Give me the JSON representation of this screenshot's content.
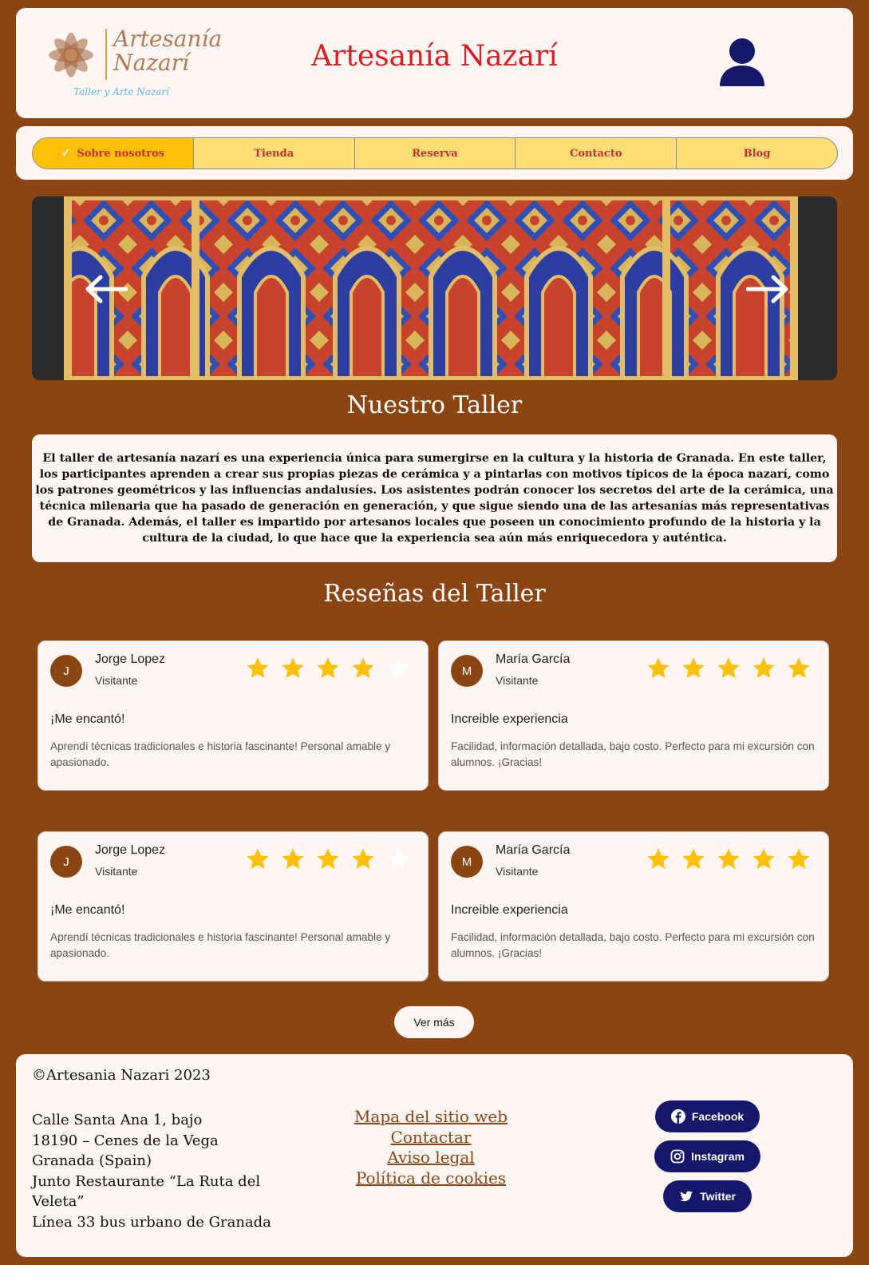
{
  "header": {
    "logo_line1": "Artesanía",
    "logo_line2": "Nazarí",
    "logo_tagline": "Taller y Arte Nazarí",
    "title": "Artesanía Nazarí"
  },
  "nav": {
    "items": [
      {
        "label": "Sobre nosotros",
        "active": true
      },
      {
        "label": "Tienda",
        "active": false
      },
      {
        "label": "Reserva",
        "active": false
      },
      {
        "label": "Contacto",
        "active": false
      },
      {
        "label": "Blog",
        "active": false
      }
    ]
  },
  "about": {
    "title": "Nuestro Taller",
    "text": "El taller de artesanía nazarí es una experiencia única para sumergirse en la cultura y la historia de Granada. En este taller, los participantes aprenden a crear sus propias piezas de cerámica y a pintarlas con motivos típicos de la época nazarí, como los patrones geométricos y las influencias andalusíes. Los asistentes podrán conocer los secretos del arte de la cerámica, una técnica milenaria que ha pasado de generación en generación, y que sigue siendo una de las artesanías más representativas de Granada. Además, el taller es impartido por artesanos locales que poseen un conocimiento profundo de la historia y la cultura de la ciudad, lo que hace que la experiencia sea aún más enriquecedora y auténtica."
  },
  "reviews": {
    "title": "Reseñas del Taller",
    "items": [
      {
        "initial": "J",
        "name": "Jorge Lopez",
        "role": "Visitante",
        "rating": 4,
        "title": "¡Me encantó!",
        "body": "Aprendí técnicas tradicionales e historia fascinante! Personal amable y apasionado."
      },
      {
        "initial": "M",
        "name": "María García",
        "role": "Visitante",
        "rating": 5,
        "title": "Increible experiencia",
        "body": "Facilidad, información detallada, bajo costo. Perfecto para mi excursión con alumnos. ¡Gracias!"
      },
      {
        "initial": "J",
        "name": "Jorge Lopez",
        "role": "Visitante",
        "rating": 4,
        "title": "¡Me encantó!",
        "body": "Aprendí técnicas tradicionales e historia fascinante! Personal amable y apasionado."
      },
      {
        "initial": "M",
        "name": "María García",
        "role": "Visitante",
        "rating": 5,
        "title": "Increible experiencia",
        "body": "Facilidad, información detallada, bajo costo. Perfecto para mi excursión con alumnos. ¡Gracias!"
      }
    ],
    "more_label": "Ver más"
  },
  "footer": {
    "copyright": "©Artesania Nazari 2023",
    "address": [
      "Calle Santa Ana 1, bajo",
      "18190 – Cenes de la Vega",
      "Granada (Spain)",
      "Junto Restaurante “La Ruta del Veleta”",
      "Línea 33 bus urbano de Granada"
    ],
    "links": [
      "Mapa del sitio web",
      "Contactar",
      "Aviso legal",
      "Política de cookies"
    ],
    "social": [
      "Facebook",
      "Instagram",
      "Twitter"
    ]
  },
  "colors": {
    "background": "#8B4513",
    "card": "#FDF6F3",
    "title_red": "#D81F26",
    "nav_yellow": "#FFDD77",
    "nav_active": "#FFC107",
    "star": "#FFC107",
    "social_button": "#16176A"
  }
}
